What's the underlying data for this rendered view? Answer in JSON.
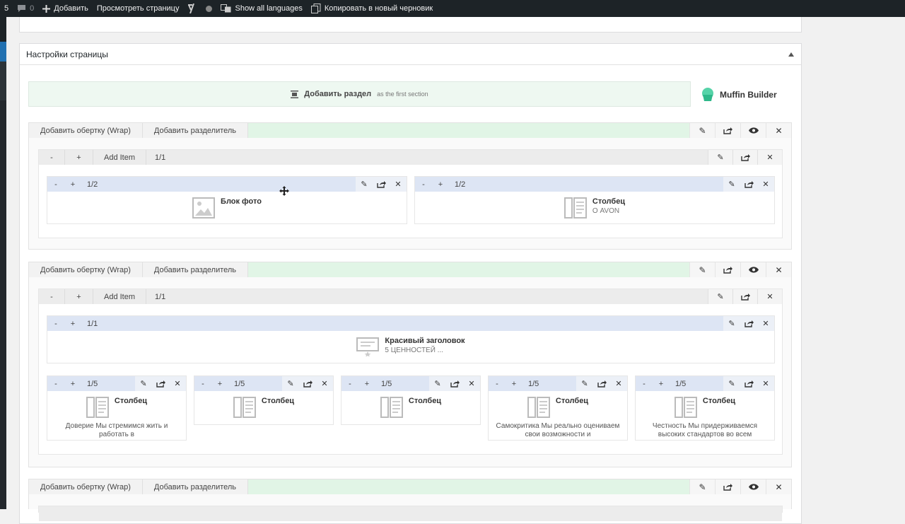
{
  "adminbar": {
    "number": "5",
    "comments_count": "0",
    "add_label": "Добавить",
    "view_page": "Просмотреть страницу",
    "languages": "Show all languages",
    "copy_draft": "Копировать в новый черновик"
  },
  "postbox": {
    "title": "Настройки страницы"
  },
  "builder": {
    "add_section": "Добавить раздел",
    "add_section_hint": "as the first section",
    "brand": "Muffin Builder",
    "sections": [
      {
        "add_wrap": "Добавить обертку (Wrap)",
        "add_divider": "Добавить разделитель",
        "wrap": {
          "minus": "-",
          "plus": "+",
          "add_item": "Add Item",
          "size": "1/1"
        },
        "columns": [
          {
            "minus": "-",
            "plus": "+",
            "size": "1/2",
            "title": "Блок фото",
            "subtitle": ""
          },
          {
            "minus": "-",
            "plus": "+",
            "size": "1/2",
            "title": "Столбец",
            "subtitle": "О AVON"
          }
        ]
      },
      {
        "add_wrap": "Добавить обертку (Wrap)",
        "add_divider": "Добавить разделитель",
        "wrap": {
          "minus": "-",
          "plus": "+",
          "add_item": "Add Item",
          "size": "1/1"
        },
        "header_column": {
          "minus": "-",
          "plus": "+",
          "size": "1/1",
          "title": "Красивый заголовок",
          "subtitle": "5 ЦЕННОСТЕЙ ..."
        },
        "columns": [
          {
            "minus": "-",
            "plus": "+",
            "size": "1/5",
            "title": "Столбец",
            "desc": "Доверие Мы стремимся жить и работать в"
          },
          {
            "minus": "-",
            "plus": "+",
            "size": "1/5",
            "title": "Столбец",
            "desc": ""
          },
          {
            "minus": "-",
            "plus": "+",
            "size": "1/5",
            "title": "Столбец",
            "desc": ""
          },
          {
            "minus": "-",
            "plus": "+",
            "size": "1/5",
            "title": "Столбец",
            "desc": "Самокритика Мы реально оцениваем свои возможности и"
          },
          {
            "minus": "-",
            "plus": "+",
            "size": "1/5",
            "title": "Столбец",
            "desc": "Честность Мы придерживаемся высоких стандартов во всем"
          }
        ]
      },
      {
        "add_wrap": "Добавить обертку (Wrap)",
        "add_divider": "Добавить разделитель"
      }
    ]
  },
  "icons": {
    "edit": "pencil-icon",
    "export": "export-icon",
    "view": "eye-icon",
    "close": "close-icon",
    "image": "image-icon",
    "column": "column-icon",
    "heading": "heading-icon"
  },
  "colors": {
    "section_bar": "#e1f5e6",
    "column_bar": "#dde5f4",
    "admin_bar": "#1d2327",
    "accent": "#2271b1"
  }
}
